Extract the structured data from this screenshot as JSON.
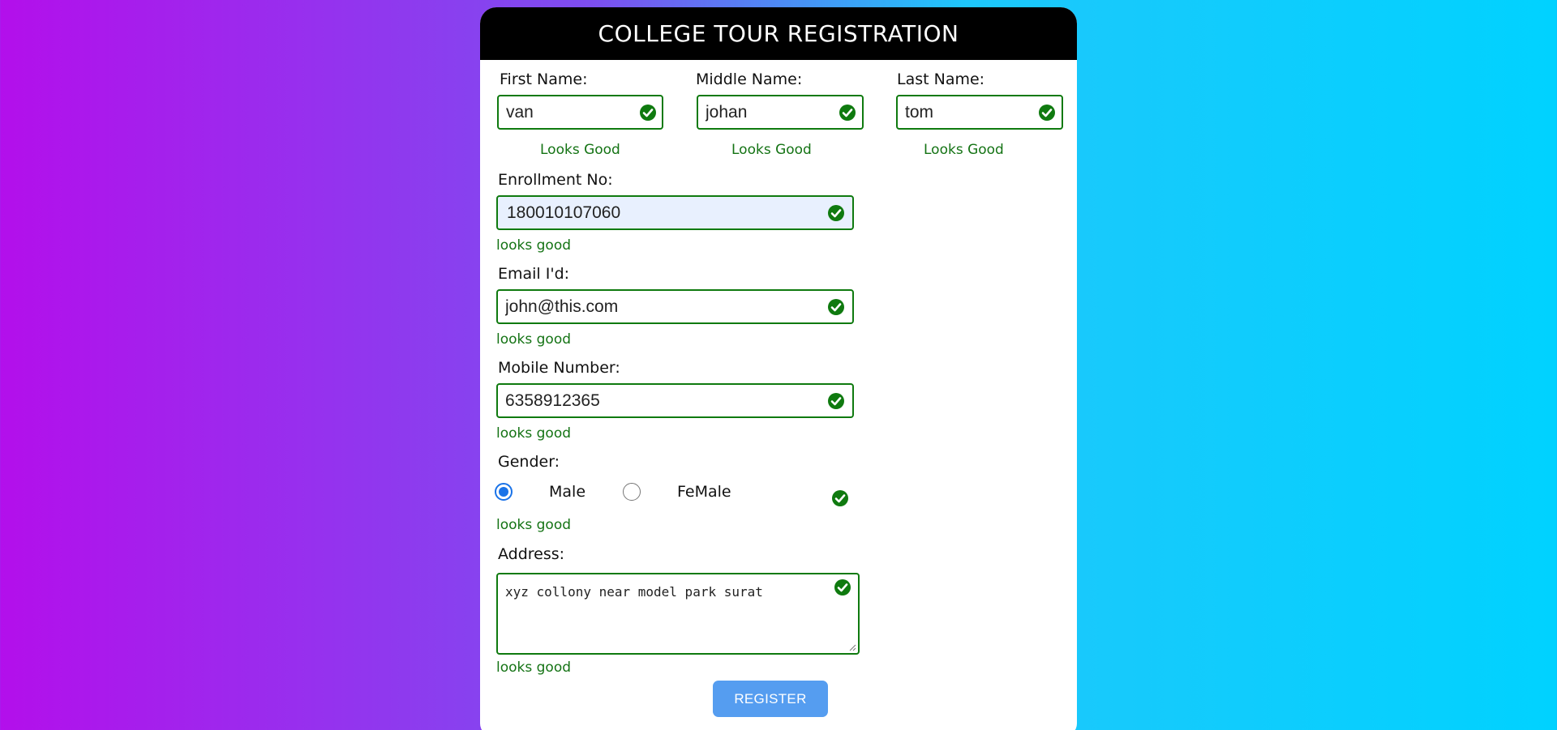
{
  "form": {
    "title": "COLLEGE TOUR REGISTRATION",
    "first_name": {
      "label": "First Name:",
      "value": "van",
      "feedback": "Looks Good"
    },
    "middle_name": {
      "label": "Middle Name:",
      "value": "johan",
      "feedback": "Looks Good"
    },
    "last_name": {
      "label": "Last Name:",
      "value": "tom",
      "feedback": "Looks Good"
    },
    "enrollment": {
      "label": "Enrollment No:",
      "value": "180010107060",
      "feedback": "looks good"
    },
    "email": {
      "label": "Email I'd:",
      "value": "john@this.com",
      "feedback": "looks good"
    },
    "mobile": {
      "label": "Mobile Number:",
      "value": "6358912365",
      "feedback": "looks good"
    },
    "gender": {
      "label": "Gender:",
      "options": [
        "Male",
        "FeMale"
      ],
      "selected": "Male",
      "feedback": "looks good"
    },
    "address": {
      "label": "Address:",
      "value": "xyz collony near model park surat",
      "feedback": "looks good"
    },
    "submit_label": "REGISTER"
  },
  "colors": {
    "valid": "#0f7a0f",
    "button": "#559df0",
    "header": "#000000"
  },
  "icons": {
    "valid": "check-circle-icon"
  }
}
